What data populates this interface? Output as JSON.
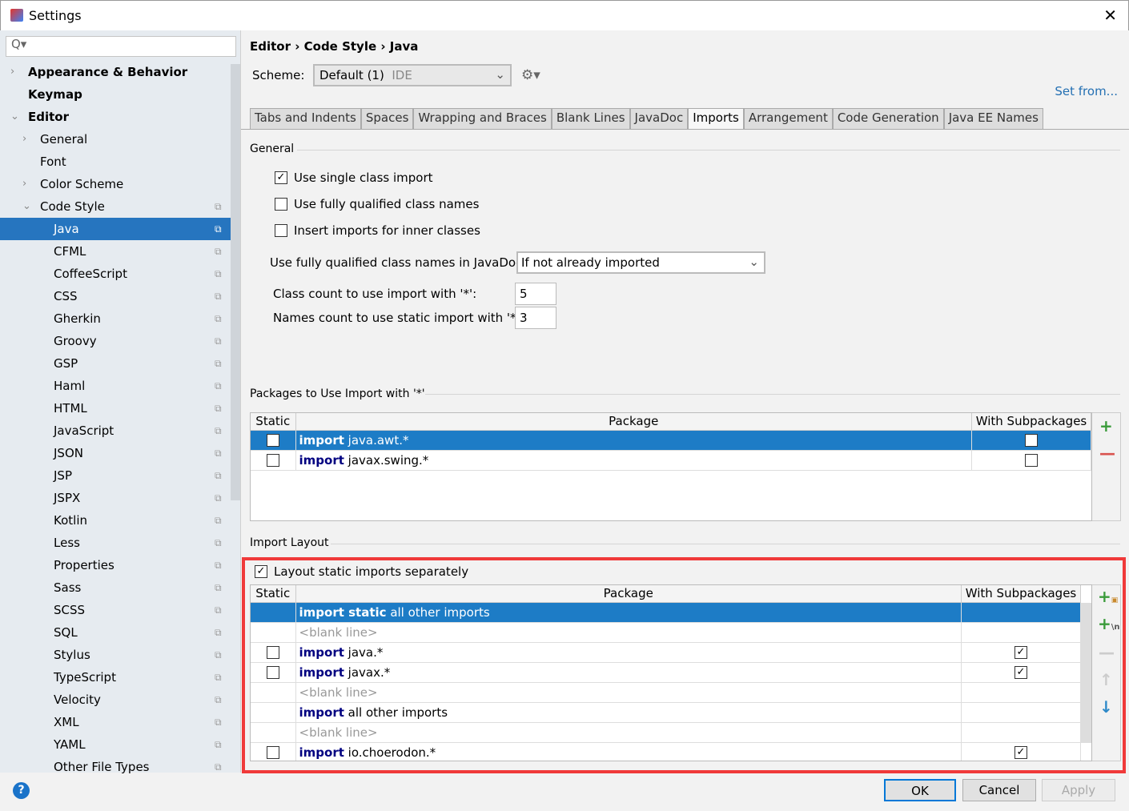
{
  "window": {
    "title": "Settings",
    "close_icon": "close-icon"
  },
  "sidebar": {
    "search_placeholder": "Q▾",
    "items": [
      {
        "label": "Appearance & Behavior",
        "level": 0,
        "arrow": "›",
        "bold": true
      },
      {
        "label": "Keymap",
        "level": 0,
        "arrow": "",
        "bold": true
      },
      {
        "label": "Editor",
        "level": 0,
        "arrow": "⌄",
        "bold": true
      },
      {
        "label": "General",
        "level": 1,
        "arrow": "›"
      },
      {
        "label": "Font",
        "level": 1,
        "arrow": ""
      },
      {
        "label": "Color Scheme",
        "level": 1,
        "arrow": "›"
      },
      {
        "label": "Code Style",
        "level": 1,
        "arrow": "⌄",
        "copy": true
      },
      {
        "label": "Java",
        "level": 2,
        "selected": true,
        "copy": true
      },
      {
        "label": "CFML",
        "level": 2,
        "copy": true
      },
      {
        "label": "CoffeeScript",
        "level": 2,
        "copy": true
      },
      {
        "label": "CSS",
        "level": 2,
        "copy": true
      },
      {
        "label": "Gherkin",
        "level": 2,
        "copy": true
      },
      {
        "label": "Groovy",
        "level": 2,
        "copy": true
      },
      {
        "label": "GSP",
        "level": 2,
        "copy": true
      },
      {
        "label": "Haml",
        "level": 2,
        "copy": true
      },
      {
        "label": "HTML",
        "level": 2,
        "copy": true
      },
      {
        "label": "JavaScript",
        "level": 2,
        "copy": true
      },
      {
        "label": "JSON",
        "level": 2,
        "copy": true
      },
      {
        "label": "JSP",
        "level": 2,
        "copy": true
      },
      {
        "label": "JSPX",
        "level": 2,
        "copy": true
      },
      {
        "label": "Kotlin",
        "level": 2,
        "copy": true
      },
      {
        "label": "Less",
        "level": 2,
        "copy": true
      },
      {
        "label": "Properties",
        "level": 2,
        "copy": true
      },
      {
        "label": "Sass",
        "level": 2,
        "copy": true
      },
      {
        "label": "SCSS",
        "level": 2,
        "copy": true
      },
      {
        "label": "SQL",
        "level": 2,
        "copy": true
      },
      {
        "label": "Stylus",
        "level": 2,
        "copy": true
      },
      {
        "label": "TypeScript",
        "level": 2,
        "copy": true
      },
      {
        "label": "Velocity",
        "level": 2,
        "copy": true
      },
      {
        "label": "XML",
        "level": 2,
        "copy": true
      },
      {
        "label": "YAML",
        "level": 2,
        "copy": true
      },
      {
        "label": "Other File Types",
        "level": 2,
        "copy": true
      }
    ]
  },
  "header": {
    "breadcrumb": "Editor › Code Style › Java",
    "scheme_label": "Scheme:",
    "scheme_value": "Default (1)",
    "scheme_tag": "IDE",
    "set_from": "Set from..."
  },
  "tabs": [
    {
      "label": "Tabs and Indents"
    },
    {
      "label": "Spaces"
    },
    {
      "label": "Wrapping and Braces"
    },
    {
      "label": "Blank Lines"
    },
    {
      "label": "JavaDoc"
    },
    {
      "label": "Imports",
      "active": true
    },
    {
      "label": "Arrangement"
    },
    {
      "label": "Code Generation"
    },
    {
      "label": "Java EE Names"
    }
  ],
  "general": {
    "title": "General",
    "single_class_import": {
      "label": "Use single class import",
      "checked": true
    },
    "fully_qualified": {
      "label": "Use fully qualified class names",
      "checked": false
    },
    "inner_classes": {
      "label": "Insert imports for inner classes",
      "checked": false
    },
    "javadoc_label": "Use fully qualified class names in JavaDoc:",
    "javadoc_value": "If not already imported",
    "class_count_label": "Class count to use import with '*':",
    "class_count": "5",
    "names_count_label": "Names count to use static import with '*':",
    "names_count": "3"
  },
  "packages": {
    "title": "Packages to Use Import with '*'",
    "headers": [
      "Static",
      "Package",
      "With Subpackages"
    ],
    "rows": [
      {
        "static": false,
        "kw": "import",
        "pkg": "java.awt.*",
        "sub": false,
        "selected": true
      },
      {
        "static": false,
        "kw": "import",
        "pkg": "javax.swing.*",
        "sub": false
      }
    ]
  },
  "layout": {
    "title": "Import Layout",
    "separate": {
      "label": "Layout static imports separately",
      "checked": true
    },
    "headers": [
      "Static",
      "Package",
      "With Subpackages"
    ],
    "rows": [
      {
        "kw": "import static",
        "pkg": "all other imports",
        "selected": true
      },
      {
        "blank": "<blank line>"
      },
      {
        "static": false,
        "kw": "import",
        "pkg": "java.*",
        "sub": true
      },
      {
        "static": false,
        "kw": "import",
        "pkg": "javax.*",
        "sub": true
      },
      {
        "blank": "<blank line>"
      },
      {
        "kw": "import",
        "pkg": "all other imports"
      },
      {
        "blank": "<blank line>"
      },
      {
        "static": false,
        "kw": "import",
        "pkg": "io.choerodon.*",
        "sub": true
      }
    ]
  },
  "buttons": {
    "ok": "OK",
    "cancel": "Cancel",
    "apply": "Apply",
    "help": "?"
  },
  "colors": {
    "selection": "#2675bf",
    "keyword": "#000080",
    "highlight_box": "#f03a3a",
    "link": "#2470b3"
  }
}
